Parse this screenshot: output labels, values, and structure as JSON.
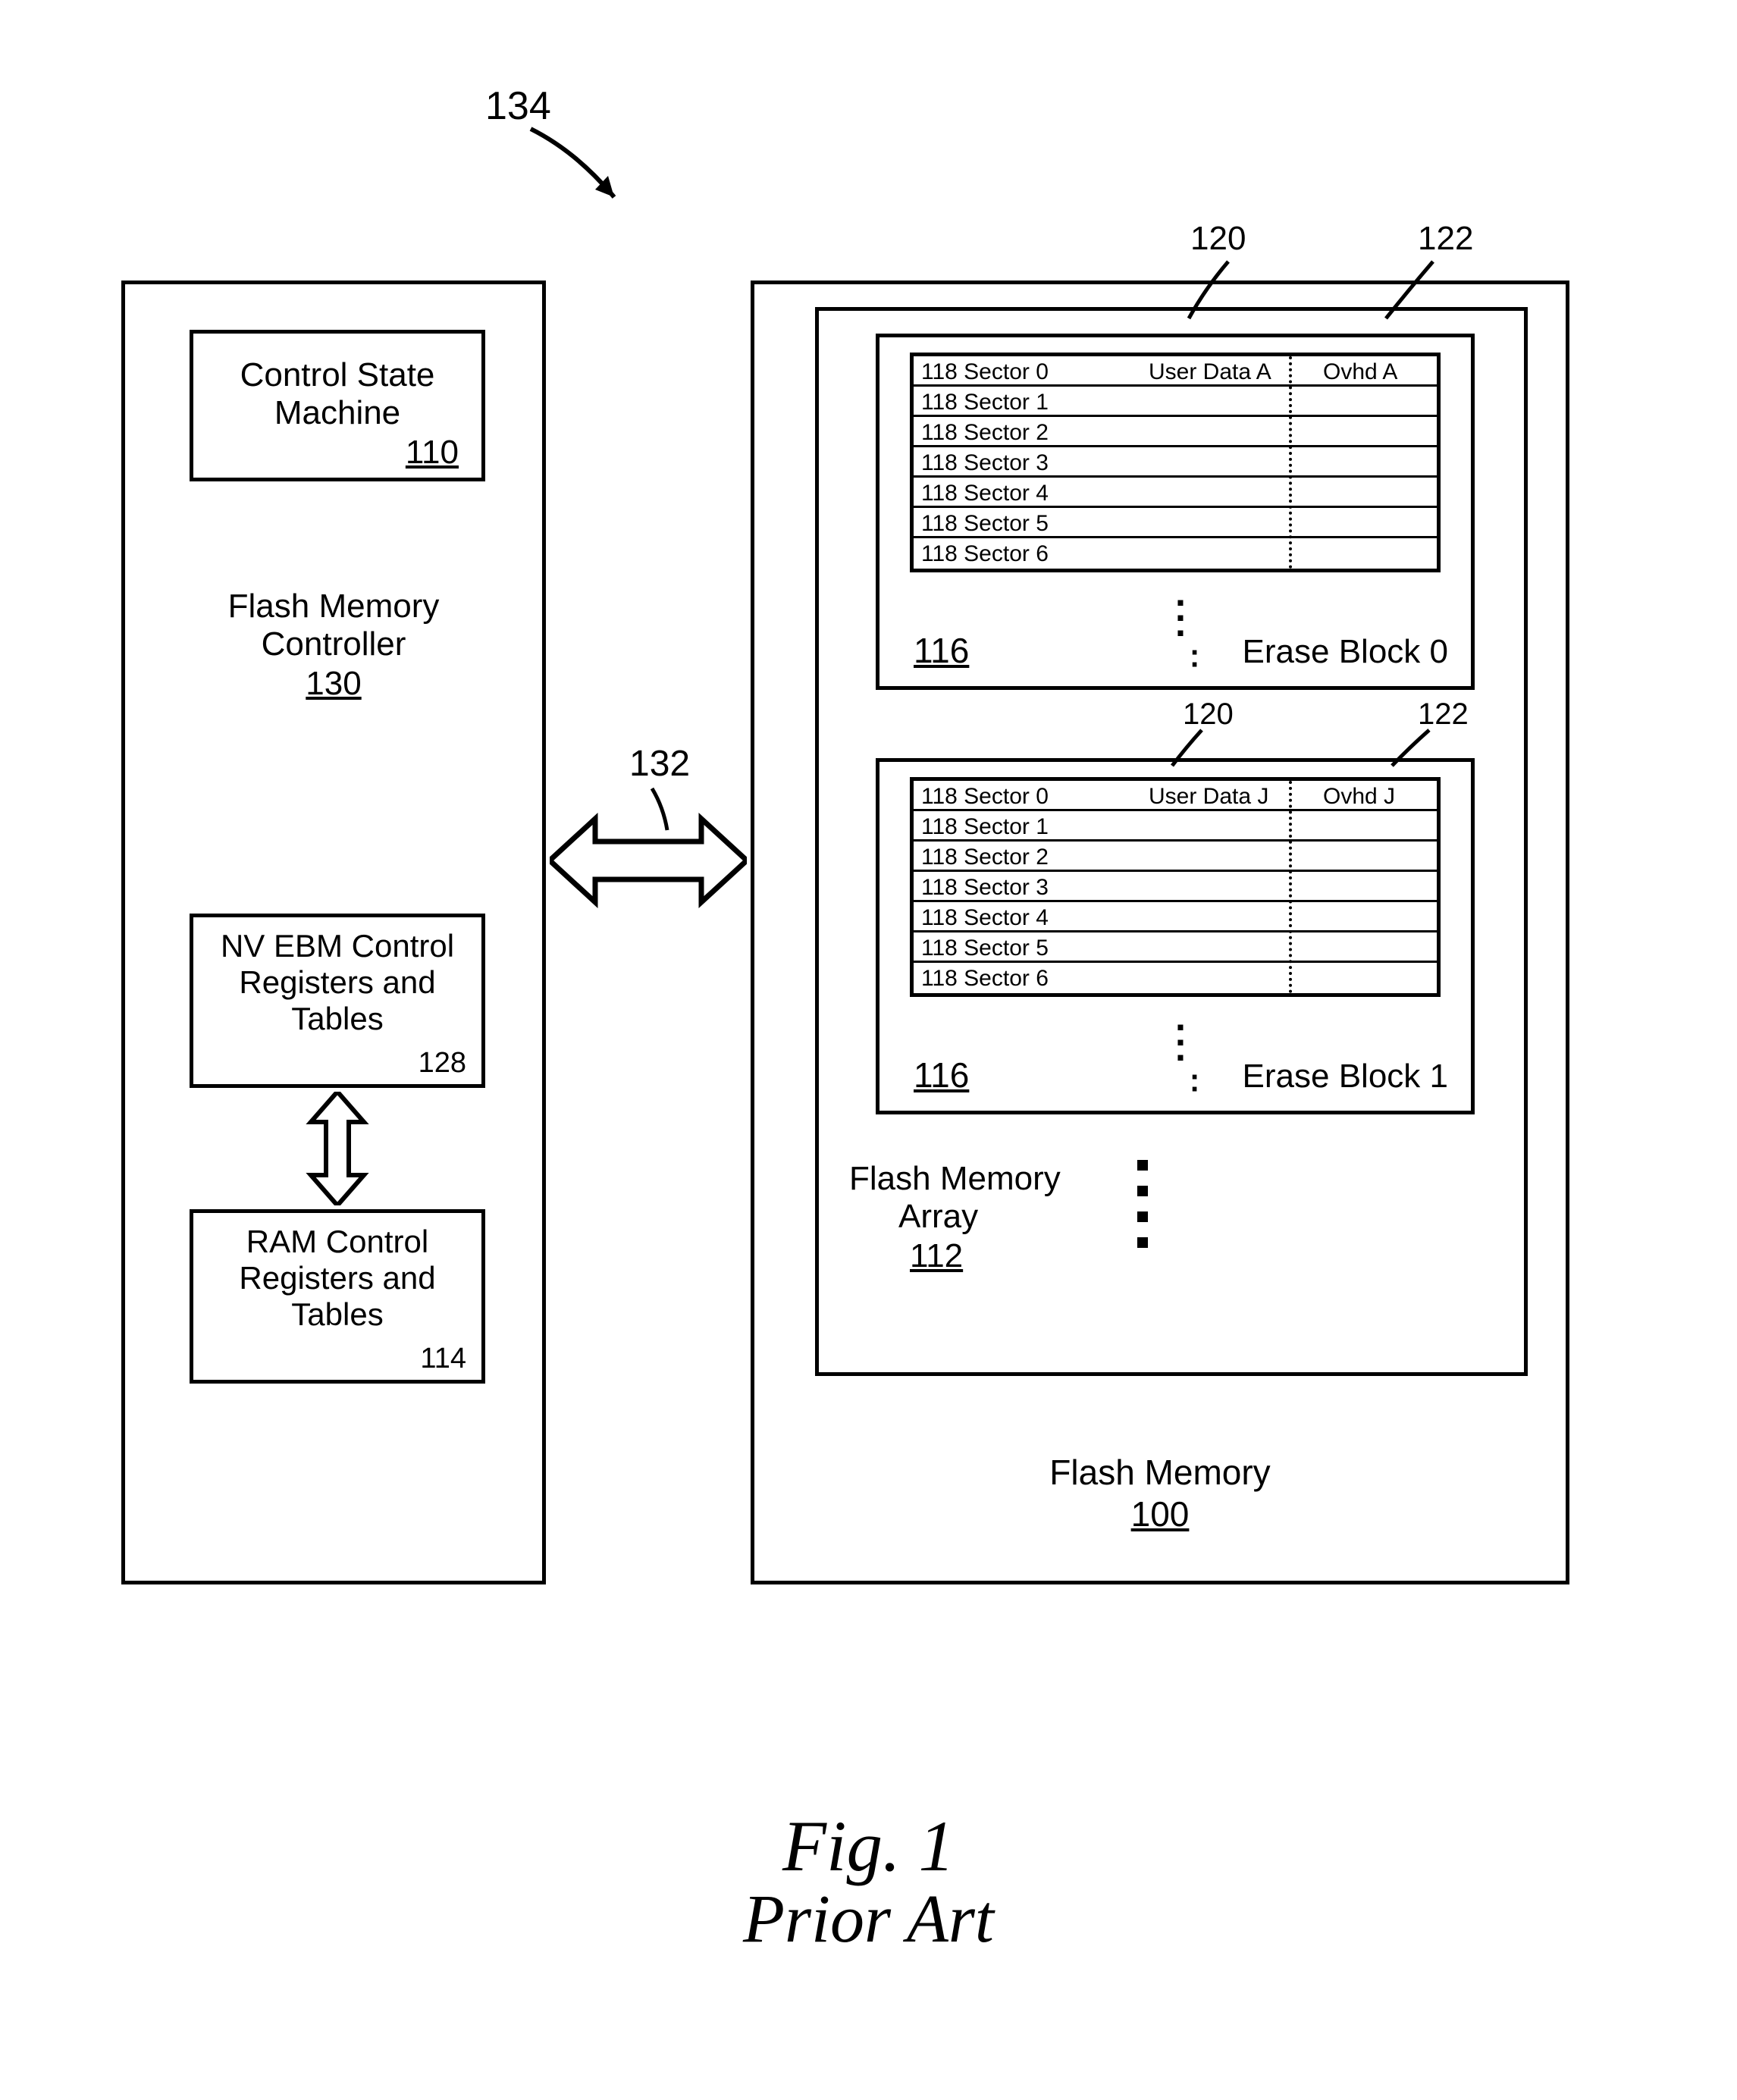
{
  "ref_top": "134",
  "controller": {
    "csm": {
      "line1": "Control State",
      "line2": "Machine",
      "num": "110"
    },
    "title": {
      "line1": "Flash Memory",
      "line2": "Controller",
      "num": "130"
    },
    "nvebm": {
      "line1": "NV EBM Control",
      "line2": "Registers and",
      "line3": "Tables",
      "num": "128"
    },
    "ram": {
      "line1": "RAM Control",
      "line2": "Registers and",
      "line3": "Tables",
      "num": "114"
    }
  },
  "bus": "132",
  "flash": {
    "title": {
      "line1": "Flash Memory",
      "num": "100"
    },
    "array": {
      "line1": "Flash Memory",
      "line2": "Array",
      "num": "112"
    },
    "col_user": "120",
    "col_ovhd": "122",
    "block0": {
      "label": "Erase Block 0",
      "num": "116",
      "sectors": [
        {
          "s": "118 Sector 0",
          "u": "User Data A",
          "o": "Ovhd A"
        },
        {
          "s": "118 Sector 1",
          "u": "",
          "o": ""
        },
        {
          "s": "118 Sector 2",
          "u": "",
          "o": ""
        },
        {
          "s": "118 Sector 3",
          "u": "",
          "o": ""
        },
        {
          "s": "118 Sector 4",
          "u": "",
          "o": ""
        },
        {
          "s": "118 Sector 5",
          "u": "",
          "o": ""
        },
        {
          "s": "118 Sector 6",
          "u": "",
          "o": ""
        }
      ]
    },
    "block1": {
      "label": "Erase Block 1",
      "num": "116",
      "sectors": [
        {
          "s": "118 Sector 0",
          "u": "User Data J",
          "o": "Ovhd J"
        },
        {
          "s": "118 Sector 1",
          "u": "",
          "o": ""
        },
        {
          "s": "118 Sector 2",
          "u": "",
          "o": ""
        },
        {
          "s": "118 Sector 3",
          "u": "",
          "o": ""
        },
        {
          "s": "118 Sector 4",
          "u": "",
          "o": ""
        },
        {
          "s": "118 Sector 5",
          "u": "",
          "o": ""
        },
        {
          "s": "118 Sector 6",
          "u": "",
          "o": ""
        }
      ]
    }
  },
  "caption": {
    "line1": "Fig. 1",
    "line2": "Prior Art"
  }
}
